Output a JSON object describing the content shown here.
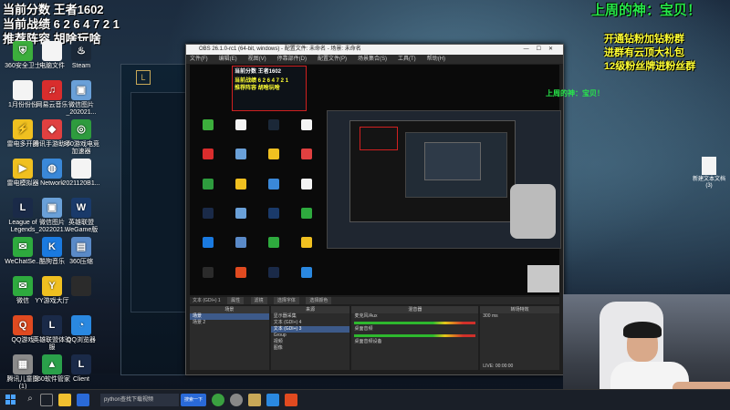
{
  "overlay": {
    "score_line": "当前分数 王者1602",
    "record_line": "当前战绩 6 2 6 4 7 2 1",
    "hero_line": "推荐阵容 胡啥玩啥",
    "weekly_god": "上周的神：宝贝！",
    "promo_1": "开通钻粉加钻粉群",
    "promo_2": "进群有云顶大礼包",
    "promo_3": "12级粉丝牌进粉丝群"
  },
  "desktop_icons": [
    {
      "label": "360安全卫士",
      "color": "#3cae3c",
      "glyph": "⛨",
      "icon": "shield-icon"
    },
    {
      "label": "电脑文件",
      "color": "#f4f4f4",
      "glyph": "",
      "icon": "document-icon"
    },
    {
      "label": "Steam",
      "color": "#1b2838",
      "glyph": "♨",
      "icon": "steam-icon"
    },
    {
      "label": "1月份份份",
      "color": "#f4f4f4",
      "glyph": "",
      "icon": "document-icon"
    },
    {
      "label": "网易云音乐",
      "color": "#d92d2d",
      "glyph": "♫",
      "icon": "music-icon"
    },
    {
      "label": "微信图片_202021...",
      "color": "#6aa0d8",
      "glyph": "▣",
      "icon": "image-icon"
    },
    {
      "label": "雷电多开器",
      "color": "#f0c020",
      "glyph": "⚡",
      "icon": "lightning-icon"
    },
    {
      "label": "腾讯手游助手",
      "color": "#e04040",
      "glyph": "◆",
      "icon": "gamepad-icon"
    },
    {
      "label": "360游戏电竞加速器",
      "color": "#2e9b3e",
      "glyph": "◎",
      "icon": "accelerator-icon"
    },
    {
      "label": "雷电模拟器",
      "color": "#f0c020",
      "glyph": "▶",
      "icon": "emulator-icon"
    },
    {
      "label": "Network",
      "color": "#3a88d8",
      "glyph": "◍",
      "icon": "network-icon"
    },
    {
      "label": "2021120B1...",
      "color": "#f4f4f4",
      "glyph": "",
      "icon": "document-icon"
    },
    {
      "label": "League of Legends",
      "color": "#1a2a48",
      "glyph": "L",
      "icon": "league-icon"
    },
    {
      "label": "微信图片_2022021...",
      "color": "#6aa0d8",
      "glyph": "▣",
      "icon": "image-icon"
    },
    {
      "label": "英雄联盟WeGame版",
      "color": "#1a3a6a",
      "glyph": "W",
      "icon": "wegame-icon"
    },
    {
      "label": "WeChatSe...",
      "color": "#2eaa3e",
      "glyph": "✉",
      "icon": "wechat-icon"
    },
    {
      "label": "酷狗音乐",
      "color": "#1a7ae0",
      "glyph": "K",
      "icon": "kugou-icon"
    },
    {
      "label": "360压缩",
      "color": "#5a8ac8",
      "glyph": "▤",
      "icon": "archive-icon"
    },
    {
      "label": "微信",
      "color": "#2eaa3e",
      "glyph": "✉",
      "icon": "wechat-icon"
    },
    {
      "label": "YY游戏大厅",
      "color": "#f0c020",
      "glyph": "Y",
      "icon": "yy-icon"
    },
    {
      "label": "",
      "color": "#2b2b2b",
      "glyph": "",
      "icon": "blank-icon"
    },
    {
      "label": "QQ游戏",
      "color": "#e04a20",
      "glyph": "Q",
      "icon": "qq-game-icon"
    },
    {
      "label": "英雄联盟体验服",
      "color": "#1a2a48",
      "glyph": "L",
      "icon": "league-icon"
    },
    {
      "label": "QQ浏览器",
      "color": "#2a88e0",
      "glyph": "◔",
      "icon": "browser-icon"
    },
    {
      "label": "腾讯儿童图 (1)",
      "color": "#8a8a8a",
      "glyph": "▦",
      "icon": "image-icon"
    },
    {
      "label": "360软件管家",
      "color": "#2aa04a",
      "glyph": "▲",
      "icon": "software-icon"
    },
    {
      "label": "Client",
      "color": "#1a2a48",
      "glyph": "L",
      "icon": "client-icon"
    }
  ],
  "right_file": "新建文本文档 (3)",
  "obs": {
    "title": "OBS 26.1.0-rc1 (64-bit, windows) - 配置文件: 未命名 - 场景: 未命名",
    "menu": [
      "文件(F)",
      "编辑(E)",
      "视图(V)",
      "停靠部件(D)",
      "配置文件(P)",
      "场景集合(S)",
      "工具(T)",
      "帮助(H)"
    ],
    "source_label": "文本 (GDI+) 1",
    "props_button": "属性",
    "filters_button": "滤镜",
    "select_font": "选择字体",
    "edit_text": "选择颜色",
    "docks": {
      "scenes_header": "场景",
      "sources_header": "来源",
      "mixer_header": "混音器",
      "transitions_header": "转场特效",
      "scenes": [
        "场景",
        "场景 2"
      ],
      "sources": [
        "显示器采集",
        "文本 (GDI+) 4",
        "文本 (GDI+) 3",
        "Group",
        "视频",
        "图像"
      ],
      "mixer": [
        "麦克风/Aux",
        "桌面音频",
        "桌面音频设备"
      ],
      "transition_duration": "300 ms",
      "status_live": "LIVE: 00:00:00",
      "status_rec": "REC: 00:00:00"
    }
  },
  "taskbar": {
    "search_text": "python查找下载视频",
    "search_button": "搜索一下"
  }
}
